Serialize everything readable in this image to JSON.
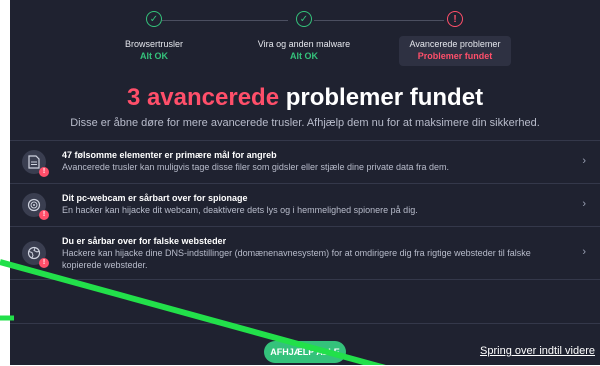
{
  "steps": [
    {
      "label": "Browsertrusler",
      "status": "Alt OK",
      "state": "done"
    },
    {
      "label": "Vira og anden malware",
      "status": "Alt OK",
      "state": "done"
    },
    {
      "label": "Avancerede problemer",
      "status": "Problemer fundet",
      "state": "alert"
    }
  ],
  "step_icons": {
    "done": "check-icon",
    "alert": "exclamation-icon",
    "done_glyph": "✓",
    "alert_glyph": "!"
  },
  "headline": {
    "accent": "3 avancerede",
    "rest": " problemer fundet"
  },
  "subtitle": "Disse er åbne døre for mere avancerede trusler. Afhjælp dem nu for at maksimere din sikkerhed.",
  "issues": [
    {
      "icon": "document-icon",
      "title": "47 følsomme elementer er primære mål for angreb",
      "desc": "Avancerede trusler kan muligvis tage disse filer som gidsler eller stjæle dine private data fra dem."
    },
    {
      "icon": "webcam-icon",
      "title": "Dit pc-webcam er sårbart over for spionage",
      "desc": "En hacker kan hijacke dit webcam, deaktivere dets lys og i hemmelighed spionere på dig."
    },
    {
      "icon": "globe-icon",
      "title": "Du er sårbar over for falske websteder",
      "desc": "Hackere kan hijacke dine DNS-indstillinger (domænenavnesystem) for at omdirigere dig fra rigtige websteder til falske kopierede websteder."
    }
  ],
  "footer": {
    "fix_label": "AFHJÆLP ALLE",
    "skip_label": "Spring over indtil videre"
  },
  "colors": {
    "panel": "#1f2230",
    "accent_red": "#ff4f6a",
    "accent_green": "#34c27b",
    "annotation_line": "#22e04a"
  }
}
